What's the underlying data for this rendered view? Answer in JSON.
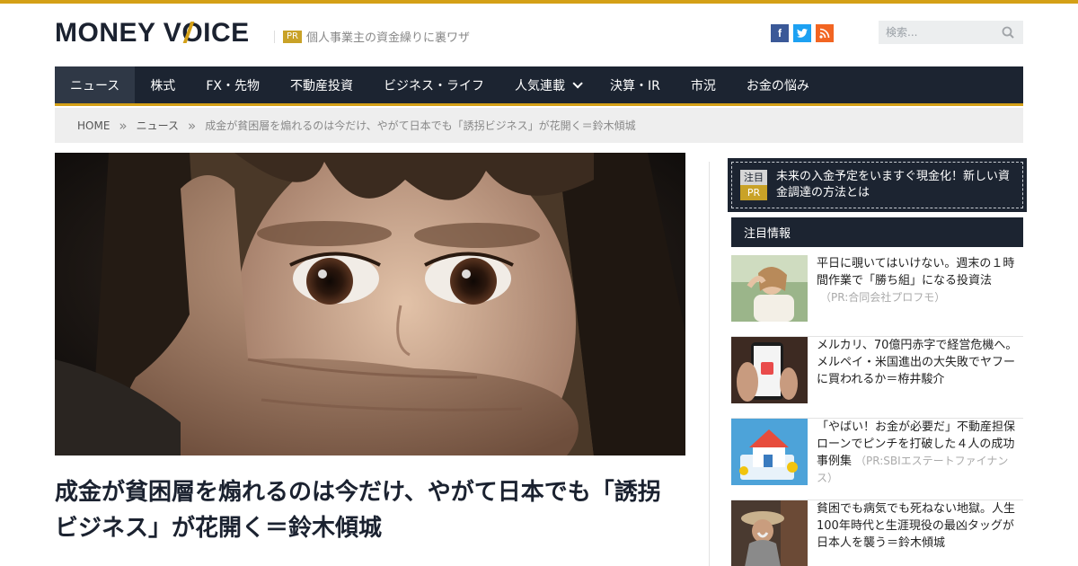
{
  "site": {
    "logo": "MONEY VOICE",
    "pr_badge": "PR",
    "pr_text": "個人事業主の資金繰りに裏ワザ"
  },
  "social": {
    "facebook": "f",
    "twitter": "t",
    "rss": "rss"
  },
  "search": {
    "placeholder": "検索..."
  },
  "nav": [
    {
      "label": "ニュース",
      "active": true
    },
    {
      "label": "株式"
    },
    {
      "label": "FX・先物"
    },
    {
      "label": "不動産投資"
    },
    {
      "label": "ビジネス・ライフ"
    },
    {
      "label": "人気連載",
      "dropdown": true
    },
    {
      "label": "決算・IR"
    },
    {
      "label": "市況"
    },
    {
      "label": "お金の悩み"
    }
  ],
  "breadcrumb": {
    "home": "HOME",
    "section": "ニュース",
    "current": "成金が貧困層を煽れるのは今だけ、やがて日本でも「誘拐ビジネス」が花開く＝鈴木傾城"
  },
  "article": {
    "title": "成金が貧困層を煽れるのは今だけ、やがて日本でも「誘拐ビジネス」が花開く＝鈴木傾城"
  },
  "sidebar": {
    "promo": {
      "badge1": "注目",
      "badge2": "PR",
      "text": "未来の入金予定をいますぐ現金化！新しい資金調達の方法とは"
    },
    "section_title": "注目情報",
    "items": [
      {
        "text": "平日に覗いてはいけない。週末の１時間作業で「勝ち組」になる投資法",
        "sponsor": "（PR:合同会社プロフモ）"
      },
      {
        "text": "メルカリ、70億円赤字で経営危機へ。メルペイ・米国進出の大失敗でヤフーに買われるか＝栫井駿介",
        "sponsor": ""
      },
      {
        "text": "「やばい！お金が必要だ」不動産担保ローンでピンチを打破した４人の成功事例集",
        "sponsor": "（PR:SBIエステートファイナンス）"
      },
      {
        "text": "貧困でも病気でも死ねない地獄。人生100年時代と生涯現役の最凶タッグが日本人を襲う＝鈴木傾城",
        "sponsor": ""
      }
    ]
  },
  "colors": {
    "accent": "#d4a017",
    "navy": "#1c2431"
  }
}
